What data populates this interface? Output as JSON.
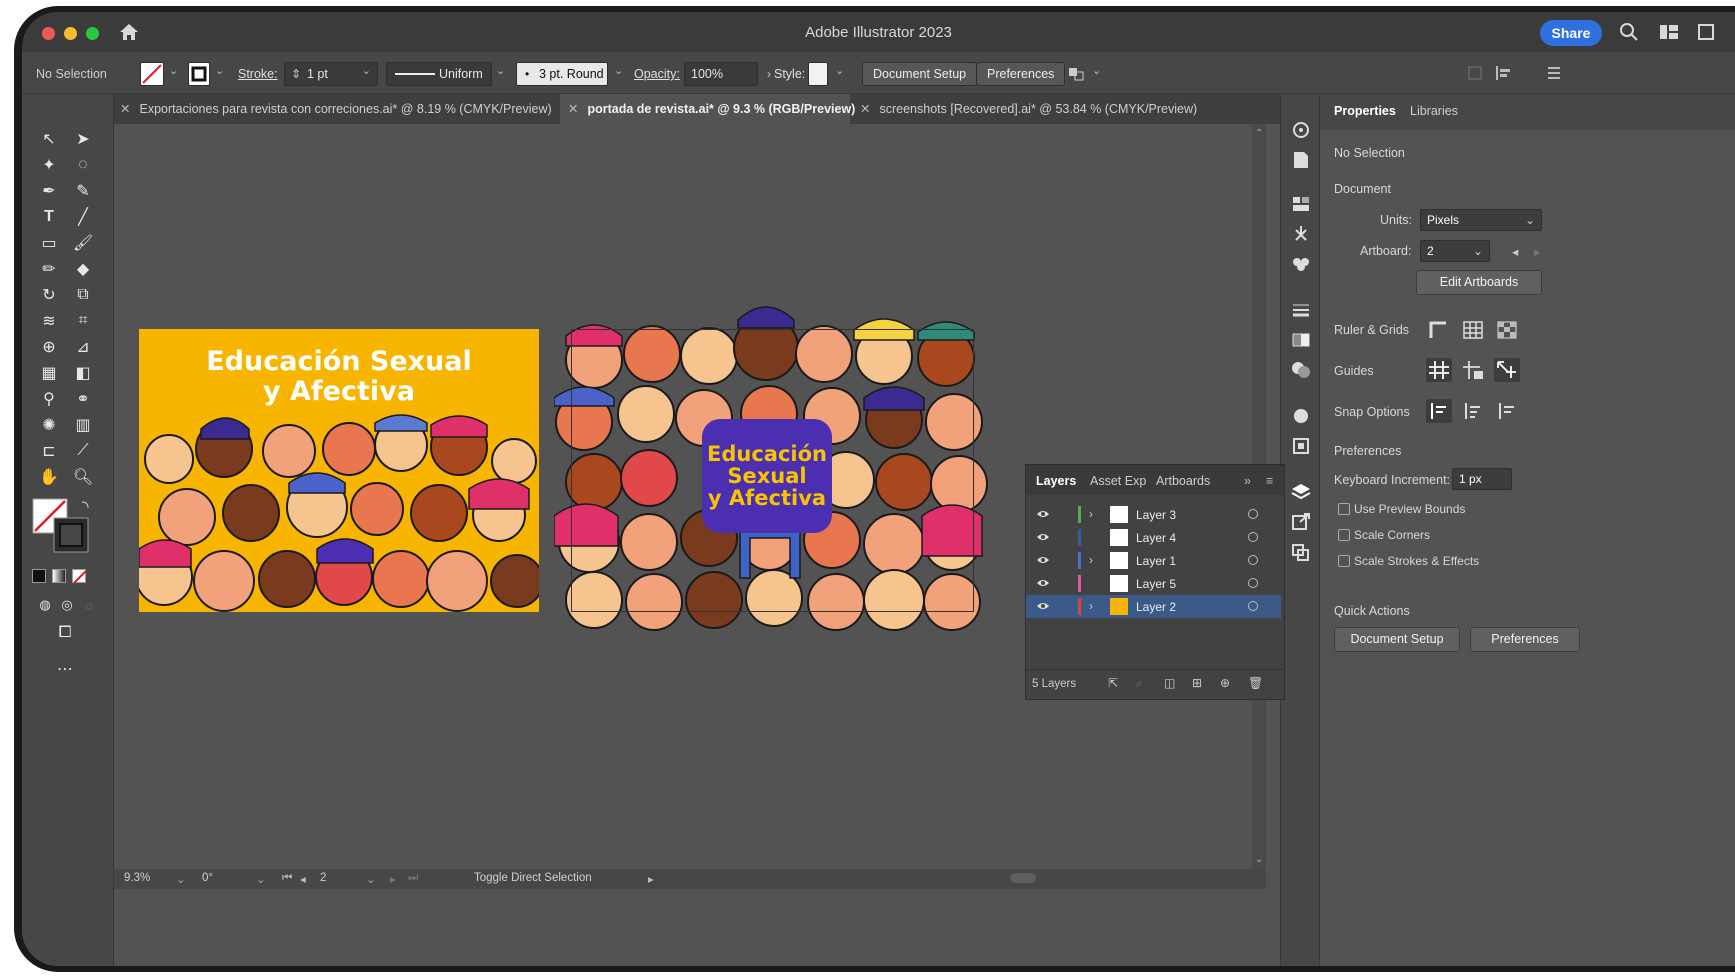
{
  "window": {
    "title": "Adobe Illustrator 2023",
    "share_label": "Share"
  },
  "control_bar": {
    "selection": "No Selection",
    "stroke_label": "Stroke:",
    "stroke_value": "1 pt",
    "profile": "Uniform",
    "brush": "3 pt. Round",
    "opacity_label": "Opacity:",
    "opacity_value": "100%",
    "style_label": "Style:",
    "document_setup": "Document Setup",
    "preferences": "Preferences"
  },
  "tabs": [
    {
      "label": "Exportaciones para revista con correciones.ai* @ 8.19 % (CMYK/Preview)",
      "active": false
    },
    {
      "label": "portada de revista.ai* @ 9.3 % (RGB/Preview)",
      "active": true
    },
    {
      "label": "screenshots [Recovered].ai* @ 53.84 % (CMYK/Preview)",
      "active": false
    }
  ],
  "artboard": {
    "title_left": "Educación Sexual\ny Afectiva",
    "title_right": "Educación\nSexual\ny Afectiva"
  },
  "status_bar": {
    "zoom": "9.3%",
    "rotation": "0°",
    "artboard_number": "2",
    "tool_hint": "Toggle Direct Selection"
  },
  "properties": {
    "tabs": [
      "Properties",
      "Libraries"
    ],
    "selection": "No Selection",
    "document_heading": "Document",
    "units_label": "Units:",
    "units_value": "Pixels",
    "artboard_label": "Artboard:",
    "artboard_value": "2",
    "edit_artboards": "Edit Artboards",
    "ruler_grids": "Ruler & Grids",
    "guides": "Guides",
    "snap_options": "Snap Options",
    "preferences_heading": "Preferences",
    "keyboard_increment_label": "Keyboard Increment:",
    "keyboard_increment_value": "1 px",
    "checkboxes": [
      "Use Preview Bounds",
      "Scale Corners",
      "Scale Strokes & Effects"
    ],
    "quick_actions": "Quick Actions",
    "document_setup": "Document Setup",
    "preferences": "Preferences"
  },
  "layers_panel": {
    "tabs": [
      "Layers",
      "Asset Exp",
      "Artboards"
    ],
    "layers": [
      {
        "name": "Layer 3",
        "color": "#4caf50",
        "expandable": true,
        "selected": false
      },
      {
        "name": "Layer 4",
        "color": "#3b5aa0",
        "expandable": false,
        "selected": false
      },
      {
        "name": "Layer 1",
        "color": "#4a6fd0",
        "expandable": true,
        "selected": false
      },
      {
        "name": "Layer 5",
        "color": "#e05aa0",
        "expandable": false,
        "selected": false
      },
      {
        "name": "Layer 2",
        "color": "#e04040",
        "expandable": true,
        "selected": true
      }
    ],
    "count_label": "5 Layers"
  },
  "colors": {
    "accent": "#2f6fe0",
    "artboard_bg": "#f7b500",
    "badge": "#4b2fb0",
    "badge_text": "#f7c400"
  }
}
